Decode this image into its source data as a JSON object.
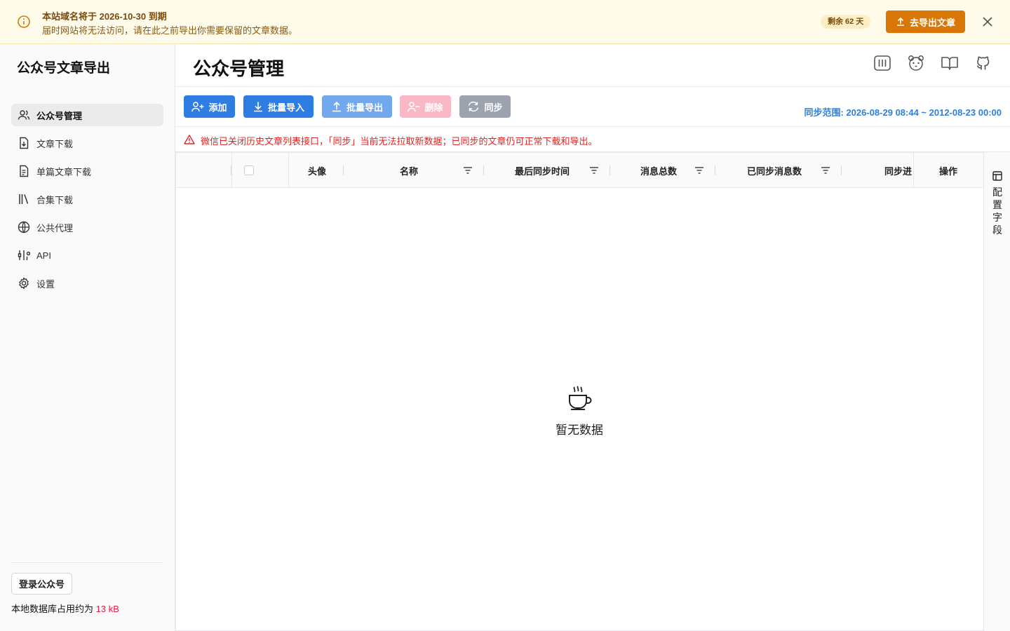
{
  "banner": {
    "line1": "本站域名将于 2026-10-30 到期",
    "line2": "届时网站将无法访问，请在此之前导出你需要保留的文章数据。",
    "remaining_badge": "剩余 62 天",
    "export_button": "去导出文章"
  },
  "sidebar": {
    "app_title": "公众号文章导出",
    "items": [
      {
        "label": "公众号管理",
        "icon": "users-icon",
        "active": true
      },
      {
        "label": "文章下载",
        "icon": "file-download-icon"
      },
      {
        "label": "单篇文章下载",
        "icon": "file-text-icon"
      },
      {
        "label": "合集下载",
        "icon": "library-icon"
      },
      {
        "label": "公共代理",
        "icon": "globe-icon"
      },
      {
        "label": "API",
        "icon": "api-icon"
      },
      {
        "label": "设置",
        "icon": "gear-icon"
      }
    ],
    "login_button": "登录公众号",
    "db_usage_label": "本地数据库占用约为 ",
    "db_usage_value": "13 kB"
  },
  "header": {
    "title": "公众号管理",
    "icons": [
      "columns-icon",
      "panda-icon",
      "book-open-icon",
      "github-icon"
    ]
  },
  "toolbar": {
    "add": "添加",
    "batch_import": "批量导入",
    "batch_export": "批量导出",
    "delete": "删除",
    "sync": "同步",
    "sync_range": "同步范围: 2026-08-29 08:44 ~ 2012-08-23 00:00"
  },
  "warning": {
    "text": "微信已关闭历史文章列表接口，「同步」当前无法拉取新数据；已同步的文章仍可正常下载和导出。"
  },
  "table": {
    "columns": [
      "头像",
      "名称",
      "最后同步时间",
      "消息总数",
      "已同步消息数",
      "同步进",
      "操作"
    ],
    "empty_text": "暂无数据"
  },
  "config_panel": {
    "label": "配置字段"
  },
  "colors": {
    "primary": "#2e7de3",
    "export_orange": "#d97706",
    "warning_red": "#dc2626",
    "delete_disabled": "#f9b8c6",
    "sync_gray": "#9ca3af"
  }
}
